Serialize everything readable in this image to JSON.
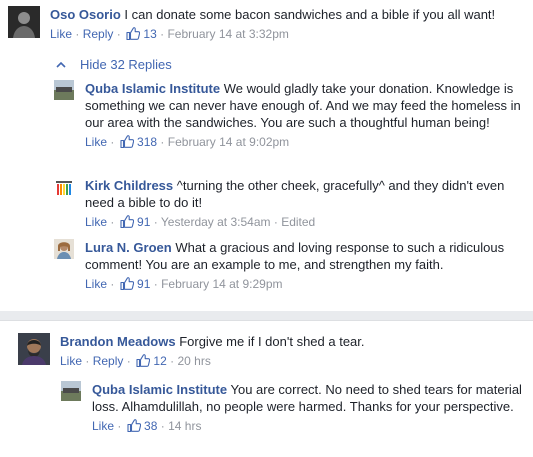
{
  "comments": [
    {
      "author": "Oso Osorio",
      "text": "I can donate some bacon sandwiches and a bible if you all want!",
      "like_label": "Like",
      "reply_label": "Reply",
      "likes": "13",
      "time": "February 14 at 3:32pm"
    },
    {
      "author": "Brandon Meadows",
      "text": "Forgive me if I don't shed a tear.",
      "like_label": "Like",
      "reply_label": "Reply",
      "likes": "12",
      "time": "20 hrs"
    }
  ],
  "replies_toggle": {
    "label": "Hide 32 Replies"
  },
  "replies": [
    {
      "author": "Quba Islamic Institute",
      "text": "We would gladly take your donation. Knowledge is something we can never have enough of. And we may feed the homeless in our area with the sandwiches. You are such a thoughtful human being!",
      "like_label": "Like",
      "likes": "318",
      "time": "February 14 at 9:02pm"
    },
    {
      "author": "Kirk Childress",
      "text": "^turning the other cheek, gracefully^ and they didn't even need a bible to do it!",
      "like_label": "Like",
      "likes": "91",
      "time": "Yesterday at 3:54am",
      "edited": "Edited"
    },
    {
      "author": "Lura N. Groen",
      "text": "What a gracious and loving response to such a ridiculous comment! You are an example to me, and strengthen my faith.",
      "like_label": "Like",
      "likes": "91",
      "time": "February 14 at 9:29pm"
    },
    {
      "author": "Quba Islamic Institute",
      "text": "You are correct. No need to shed tears for material loss. Alhamdulillah, no people were harmed. Thanks for your perspective.",
      "like_label": "Like",
      "likes": "38",
      "time": "14 hrs"
    }
  ],
  "colors": {
    "link": "#365899",
    "action": "#4267b2",
    "meta": "#90949c",
    "text": "#1d2129",
    "gap": "#e9ebee"
  },
  "icons": {
    "like": "thumbs-up-icon",
    "toggle": "chevron-up-icon"
  }
}
